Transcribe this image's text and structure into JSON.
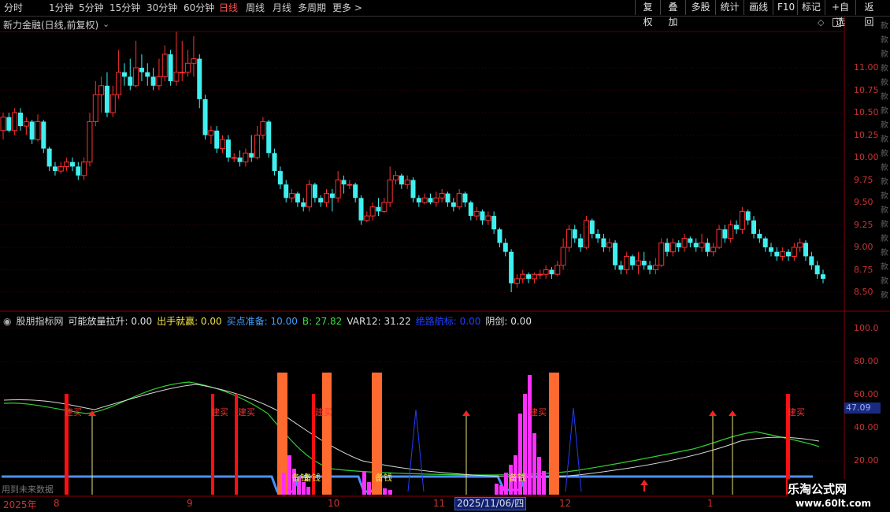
{
  "toolbar": {
    "periods": [
      "分时",
      "1分钟",
      "5分钟",
      "15分钟",
      "30分钟",
      "60分钟",
      "日线",
      "周线",
      "月线",
      "多周期",
      "更多 >"
    ],
    "active_period": "日线",
    "right_buttons": [
      "复权",
      "叠加",
      "多股",
      "统计",
      "画线",
      "F10",
      "标记",
      "+自选",
      "返回"
    ]
  },
  "stock": {
    "title": "新力金融(日线,前复权)"
  },
  "price_axis": {
    "labels": [
      "11.00",
      "10.75",
      "10.50",
      "10.25",
      "10.00",
      "9.75",
      "9.50",
      "9.25",
      "9.00",
      "8.75",
      "8.50"
    ]
  },
  "indicator": {
    "name": "股朋指标网",
    "items": [
      {
        "label": "可能放量拉升:",
        "value": "0.00",
        "color": "#e0e0e0"
      },
      {
        "label": "出手就赢:",
        "value": "0.00",
        "color": "#f0e040"
      },
      {
        "label": "买点准备:",
        "value": "10.00",
        "color": "#40a0ff"
      },
      {
        "label": "B:",
        "value": "27.82",
        "color": "#40e040"
      },
      {
        "label": "VAR12:",
        "value": "31.22",
        "color": "#e0e0e0"
      },
      {
        "label": "绝路航标:",
        "value": "0.00",
        "color": "#2040ff"
      },
      {
        "label": "阴剑:",
        "value": "0.00",
        "color": "#e0e0e0"
      }
    ],
    "axis_labels": [
      "100.0",
      "80.00",
      "60.00",
      "40.00",
      "20.00"
    ],
    "current_value": "47.09",
    "signal_buy": "建买",
    "signal_ready": "备钱",
    "future_text": "用到未来数据"
  },
  "dates": {
    "labels": [
      "2025年",
      "8",
      "9",
      "10",
      "11",
      "12",
      "1"
    ],
    "selected": "2025/11/06/四"
  },
  "watermark": {
    "line1": "乐淘公式网",
    "line2": "www.60lt.com"
  },
  "colors": {
    "up": "#ff3030",
    "down": "#40f0f0",
    "grid": "#5a0000"
  },
  "chart_data": {
    "type": "candlestick",
    "title": "新力金融(日线,前复权)",
    "ylim": [
      8.4,
      11.5
    ],
    "candles": [
      [
        10.3,
        10.45,
        10.2,
        10.5
      ],
      [
        10.45,
        10.3,
        10.28,
        10.5
      ],
      [
        10.3,
        10.5,
        10.25,
        10.55
      ],
      [
        10.5,
        10.35,
        10.3,
        10.55
      ],
      [
        10.35,
        10.4,
        10.25,
        10.45
      ],
      [
        10.4,
        10.2,
        10.15,
        10.42
      ],
      [
        10.2,
        10.4,
        10.18,
        10.48
      ],
      [
        10.4,
        10.1,
        10.05,
        10.42
      ],
      [
        10.1,
        9.9,
        9.85,
        10.12
      ],
      [
        9.9,
        9.85,
        9.8,
        9.95
      ],
      [
        9.85,
        9.9,
        9.82,
        9.95
      ],
      [
        9.9,
        9.95,
        9.85,
        10.0
      ],
      [
        9.95,
        9.9,
        9.85,
        10.0
      ],
      [
        9.9,
        9.8,
        9.75,
        9.95
      ],
      [
        9.8,
        9.95,
        9.75,
        10.0
      ],
      [
        9.95,
        10.4,
        9.9,
        10.5
      ],
      [
        10.4,
        10.7,
        10.35,
        10.85
      ],
      [
        10.7,
        10.8,
        10.5,
        10.9
      ],
      [
        10.8,
        10.5,
        10.45,
        10.95
      ],
      [
        10.5,
        10.7,
        10.45,
        10.8
      ],
      [
        10.7,
        10.95,
        10.65,
        11.2
      ],
      [
        10.95,
        10.9,
        10.8,
        11.05
      ],
      [
        10.9,
        10.8,
        10.75,
        11.1
      ],
      [
        10.8,
        11.0,
        10.78,
        11.3
      ],
      [
        11.0,
        10.95,
        10.85,
        11.15
      ],
      [
        10.95,
        10.9,
        10.8,
        11.05
      ],
      [
        10.9,
        10.8,
        10.75,
        11.0
      ],
      [
        10.8,
        10.9,
        10.75,
        11.1
      ],
      [
        10.9,
        11.15,
        10.85,
        11.25
      ],
      [
        11.15,
        10.85,
        10.8,
        11.2
      ],
      [
        10.85,
        10.95,
        10.8,
        11.4
      ],
      [
        10.95,
        10.95,
        10.85,
        11.3
      ],
      [
        10.95,
        11.05,
        10.9,
        11.2
      ],
      [
        11.05,
        11.1,
        10.9,
        11.35
      ],
      [
        11.1,
        10.65,
        10.55,
        11.15
      ],
      [
        10.65,
        10.25,
        10.2,
        10.7
      ],
      [
        10.25,
        10.3,
        10.15,
        10.35
      ],
      [
        10.3,
        10.1,
        10.05,
        10.35
      ],
      [
        10.1,
        10.2,
        10.05,
        10.25
      ],
      [
        10.2,
        10.0,
        9.95,
        10.25
      ],
      [
        10.0,
        10.0,
        9.95,
        10.05
      ],
      [
        10.0,
        9.95,
        9.9,
        10.08
      ],
      [
        9.95,
        10.05,
        9.9,
        10.1
      ],
      [
        10.05,
        10.0,
        9.95,
        10.25
      ],
      [
        10.0,
        10.25,
        9.98,
        10.35
      ],
      [
        10.25,
        10.4,
        10.2,
        10.45
      ],
      [
        10.4,
        10.05,
        10.0,
        10.42
      ],
      [
        10.05,
        9.85,
        9.8,
        10.1
      ],
      [
        9.85,
        9.7,
        9.65,
        9.9
      ],
      [
        9.7,
        9.55,
        9.5,
        9.75
      ],
      [
        9.55,
        9.6,
        9.5,
        9.65
      ],
      [
        9.6,
        9.5,
        9.45,
        9.62
      ],
      [
        9.5,
        9.45,
        9.4,
        9.55
      ],
      [
        9.45,
        9.7,
        9.4,
        9.75
      ],
      [
        9.7,
        9.55,
        9.5,
        9.72
      ],
      [
        9.55,
        9.5,
        9.45,
        9.58
      ],
      [
        9.5,
        9.6,
        9.45,
        9.65
      ],
      [
        9.6,
        9.55,
        9.4,
        9.65
      ],
      [
        9.55,
        9.75,
        9.5,
        9.85
      ],
      [
        9.75,
        9.7,
        9.6,
        9.8
      ],
      [
        9.7,
        9.7,
        9.65,
        9.75
      ],
      [
        9.7,
        9.55,
        9.5,
        9.72
      ],
      [
        9.55,
        9.3,
        9.25,
        9.58
      ],
      [
        9.3,
        9.35,
        9.28,
        9.4
      ],
      [
        9.35,
        9.45,
        9.3,
        9.5
      ],
      [
        9.45,
        9.4,
        9.35,
        9.55
      ],
      [
        9.4,
        9.5,
        9.38,
        9.55
      ],
      [
        9.5,
        9.75,
        9.45,
        9.9
      ],
      [
        9.75,
        9.8,
        9.7,
        9.85
      ],
      [
        9.8,
        9.7,
        9.65,
        9.82
      ],
      [
        9.7,
        9.75,
        9.65,
        9.8
      ],
      [
        9.75,
        9.55,
        9.5,
        9.78
      ],
      [
        9.55,
        9.5,
        9.45,
        9.58
      ],
      [
        9.5,
        9.55,
        9.48,
        9.6
      ],
      [
        9.55,
        9.5,
        9.48,
        9.6
      ],
      [
        9.5,
        9.55,
        9.45,
        9.62
      ],
      [
        9.55,
        9.6,
        9.5,
        9.65
      ],
      [
        9.6,
        9.5,
        9.45,
        9.62
      ],
      [
        9.5,
        9.45,
        9.4,
        9.55
      ],
      [
        9.45,
        9.6,
        9.42,
        9.65
      ],
      [
        9.6,
        9.5,
        9.45,
        9.62
      ],
      [
        9.5,
        9.35,
        9.3,
        9.52
      ],
      [
        9.35,
        9.4,
        9.3,
        9.45
      ],
      [
        9.4,
        9.3,
        9.25,
        9.42
      ],
      [
        9.3,
        9.35,
        9.25,
        9.4
      ],
      [
        9.35,
        9.2,
        9.15,
        9.4
      ],
      [
        9.2,
        9.05,
        9.0,
        9.22
      ],
      [
        9.05,
        8.95,
        8.9,
        9.1
      ],
      [
        8.95,
        8.6,
        8.5,
        8.98
      ],
      [
        8.6,
        8.65,
        8.55,
        8.7
      ],
      [
        8.65,
        8.7,
        8.6,
        8.75
      ],
      [
        8.7,
        8.65,
        8.6,
        8.72
      ],
      [
        8.65,
        8.7,
        8.6,
        8.72
      ],
      [
        8.7,
        8.7,
        8.65,
        8.75
      ],
      [
        8.7,
        8.75,
        8.65,
        8.8
      ],
      [
        8.75,
        8.7,
        8.65,
        8.78
      ],
      [
        8.7,
        8.8,
        8.68,
        8.85
      ],
      [
        8.8,
        9.0,
        8.75,
        9.1
      ],
      [
        9.0,
        9.2,
        8.95,
        9.25
      ],
      [
        9.2,
        9.1,
        9.05,
        9.25
      ],
      [
        9.1,
        9.0,
        8.95,
        9.15
      ],
      [
        9.0,
        9.3,
        8.98,
        9.35
      ],
      [
        9.3,
        9.15,
        9.1,
        9.32
      ],
      [
        9.15,
        9.1,
        9.05,
        9.2
      ],
      [
        9.1,
        9.0,
        8.95,
        9.15
      ],
      [
        9.0,
        9.05,
        8.95,
        9.1
      ],
      [
        9.05,
        8.8,
        8.75,
        9.08
      ],
      [
        8.8,
        8.75,
        8.7,
        8.85
      ],
      [
        8.75,
        8.9,
        8.7,
        8.95
      ],
      [
        8.9,
        8.8,
        8.75,
        8.92
      ],
      [
        8.8,
        8.85,
        8.7,
        8.95
      ],
      [
        8.85,
        8.8,
        8.75,
        8.95
      ],
      [
        8.8,
        8.75,
        8.7,
        8.85
      ],
      [
        8.75,
        8.8,
        8.7,
        8.88
      ],
      [
        8.8,
        9.05,
        8.78,
        9.1
      ],
      [
        9.05,
        8.95,
        8.9,
        9.1
      ],
      [
        8.95,
        9.05,
        8.9,
        9.1
      ],
      [
        9.05,
        9.0,
        8.95,
        9.08
      ],
      [
        9.0,
        9.1,
        8.95,
        9.15
      ],
      [
        9.1,
        9.05,
        9.0,
        9.12
      ],
      [
        9.05,
        9.0,
        8.95,
        9.1
      ],
      [
        9.0,
        9.05,
        8.95,
        9.15
      ],
      [
        9.05,
        8.95,
        8.9,
        9.1
      ],
      [
        8.95,
        9.0,
        8.9,
        9.05
      ],
      [
        9.0,
        9.2,
        8.98,
        9.25
      ],
      [
        9.2,
        9.1,
        9.05,
        9.25
      ],
      [
        9.1,
        9.25,
        9.05,
        9.3
      ],
      [
        9.25,
        9.2,
        9.15,
        9.3
      ],
      [
        9.2,
        9.4,
        9.15,
        9.45
      ],
      [
        9.4,
        9.3,
        9.25,
        9.42
      ],
      [
        9.3,
        9.15,
        9.1,
        9.35
      ],
      [
        9.15,
        9.1,
        9.05,
        9.2
      ],
      [
        9.1,
        9.0,
        8.95,
        9.12
      ],
      [
        9.0,
        8.95,
        8.9,
        9.05
      ],
      [
        8.95,
        8.9,
        8.85,
        9.0
      ],
      [
        8.9,
        8.95,
        8.85,
        9.0
      ],
      [
        8.95,
        8.9,
        8.85,
        8.98
      ],
      [
        8.9,
        9.0,
        8.85,
        9.05
      ],
      [
        9.0,
        9.05,
        8.95,
        9.1
      ],
      [
        9.05,
        8.9,
        8.85,
        9.08
      ],
      [
        8.9,
        8.8,
        8.75,
        8.95
      ],
      [
        8.8,
        8.7,
        8.65,
        8.85
      ],
      [
        8.7,
        8.65,
        8.6,
        8.75
      ]
    ]
  }
}
